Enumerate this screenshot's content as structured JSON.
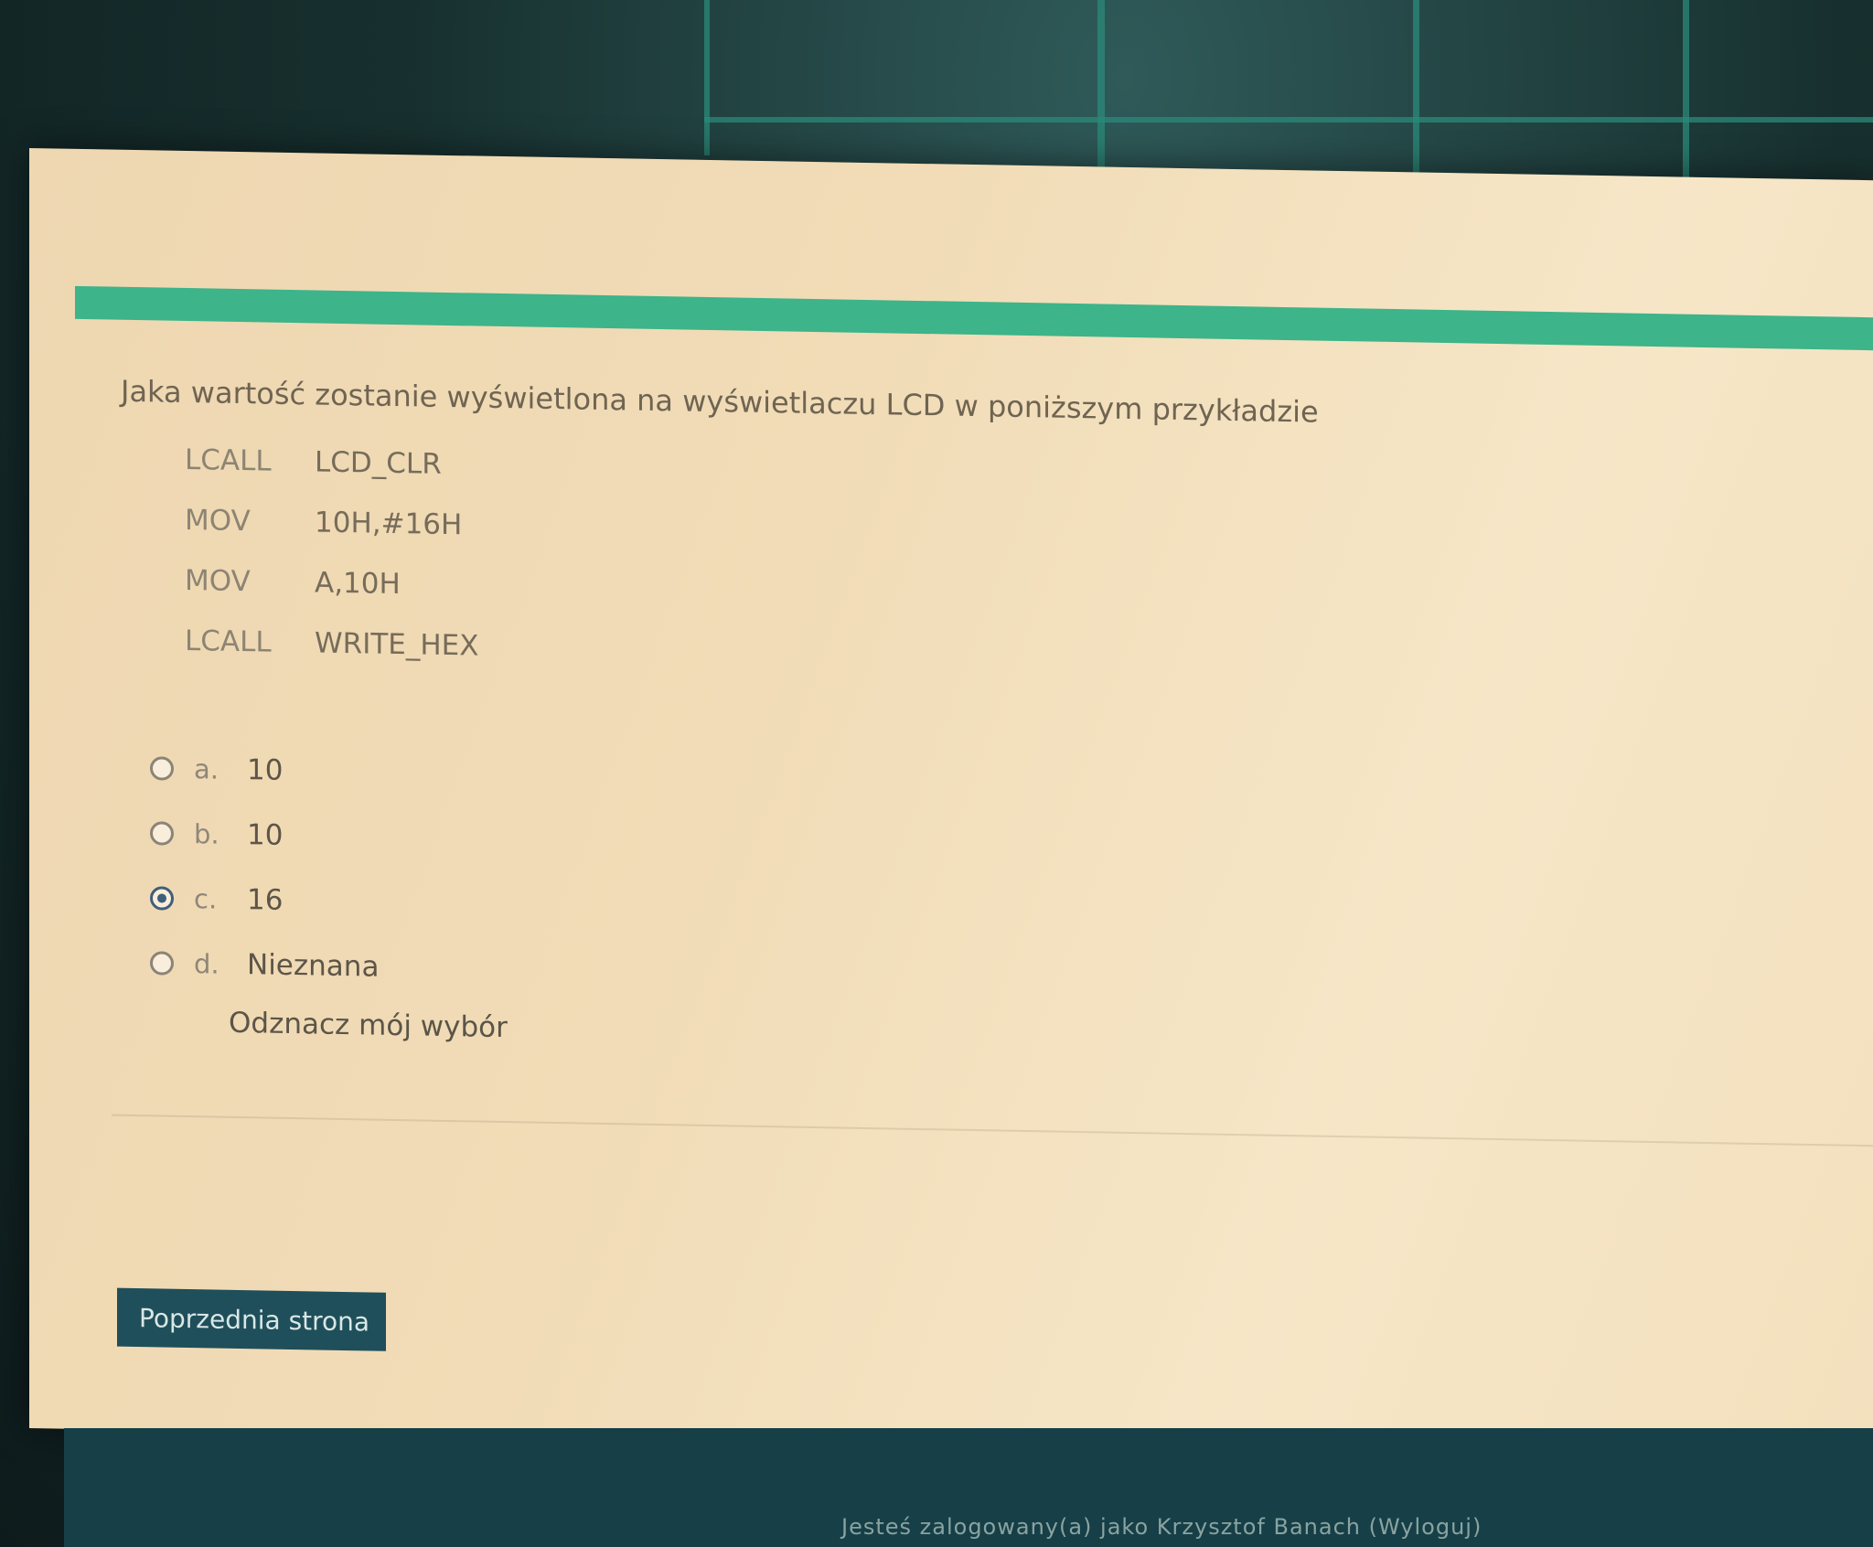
{
  "question": {
    "text": "Jaka wartość zostanie wyświetlona na wyświetlaczu LCD w poniższym przykładzie",
    "code": [
      {
        "op": "LCALL",
        "arg": "LCD_CLR"
      },
      {
        "op": "MOV",
        "arg": "10H,#16H"
      },
      {
        "op": "MOV",
        "arg": "A,10H"
      },
      {
        "op": "LCALL",
        "arg": "WRITE_HEX"
      }
    ]
  },
  "answers": [
    {
      "letter": "a.",
      "text": "10",
      "selected": false
    },
    {
      "letter": "b.",
      "text": "10",
      "selected": false
    },
    {
      "letter": "c.",
      "text": "16",
      "selected": true
    },
    {
      "letter": "d.",
      "text": "Nieznana",
      "selected": false
    }
  ],
  "clear_choice_label": "Odznacz mój wybór",
  "navigation": {
    "previous_page_label": "Poprzednia strona"
  },
  "footer": {
    "logged_in_prefix": "Jesteś zalogowany(a) jako",
    "user_name": "Krzysztof Banach",
    "logout_label": "(Wyloguj)"
  },
  "colors": {
    "header_bar": "#3db489",
    "button_bg": "#1f4f5a",
    "footer_bg": "#163f47",
    "page_bg": "#f1dcb7"
  }
}
